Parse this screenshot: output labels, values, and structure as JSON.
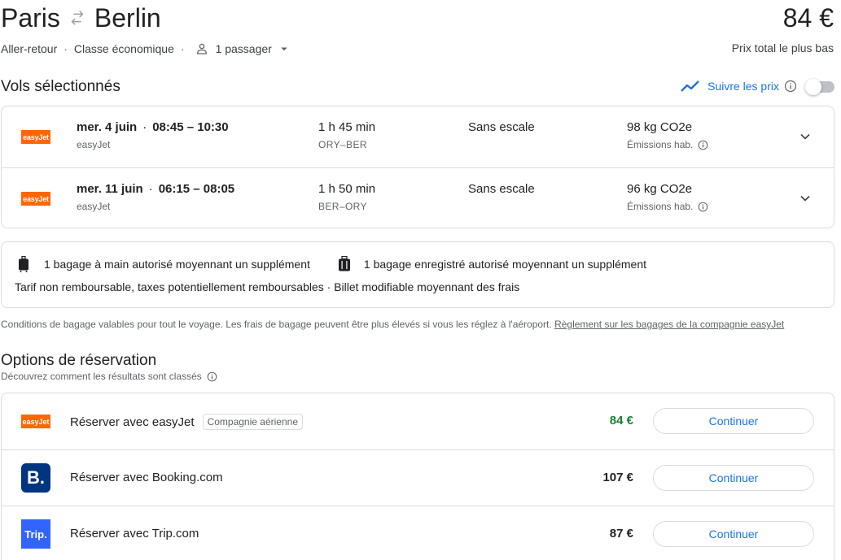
{
  "header": {
    "origin": "Paris",
    "destination": "Berlin",
    "total_price": "84 €",
    "total_price_label": "Prix total le plus bas",
    "trip_type": "Aller-retour",
    "cabin_class": "Classe économique",
    "passengers": "1 passager"
  },
  "selected": {
    "title": "Vols sélectionnés",
    "track_prices_label": "Suivre les prix",
    "track_enabled": false,
    "flights": [
      {
        "logo": "easyJet",
        "date": "mer. 4 juin",
        "times": "08:45 – 10:30",
        "airline": "easyJet",
        "duration": "1 h 45 min",
        "airports": "ORY–BER",
        "stops": "Sans escale",
        "co2": "98 kg CO2e",
        "emissions_label": "Émissions hab."
      },
      {
        "logo": "easyJet",
        "date": "mer. 11 juin",
        "times": "06:15 – 08:05",
        "airline": "easyJet",
        "duration": "1 h 50 min",
        "airports": "BER–ORY",
        "stops": "Sans escale",
        "co2": "96 kg CO2e",
        "emissions_label": "Émissions hab."
      }
    ]
  },
  "baggage": {
    "carry_on": "1 bagage à main autorisé moyennant un supplément",
    "checked": "1 bagage enregistré autorisé moyennant un supplément",
    "fare_info": "Tarif non remboursable, taxes potentiellement remboursables · Billet modifiable moyennant des frais",
    "note": "Conditions de bagage valables pour tout le voyage. Les frais de bagage peuvent être plus élevés si vous les réglez à l'aéroport.",
    "policy_link": "Règlement sur les bagages de la compagnie easyJet"
  },
  "booking": {
    "title": "Options de réservation",
    "subtitle": "Découvrez comment les résultats sont classés",
    "options": [
      {
        "logo": "easyJet",
        "name": "Réserver avec easyJet",
        "badge": "Compagnie aérienne",
        "price": "84 €",
        "button": "Continuer"
      },
      {
        "logo": "B.",
        "name": "Réserver avec Booking.com",
        "price": "107 €",
        "button": "Continuer"
      },
      {
        "logo": "Trip.",
        "name": "Réserver avec Trip.com",
        "price": "87 €",
        "button": "Continuer"
      }
    ]
  },
  "colors": {
    "accent": "#1a73e8",
    "easyjet": "#ff6600",
    "booking": "#003580",
    "trip": "#3264ff",
    "best_price": "#188038"
  }
}
